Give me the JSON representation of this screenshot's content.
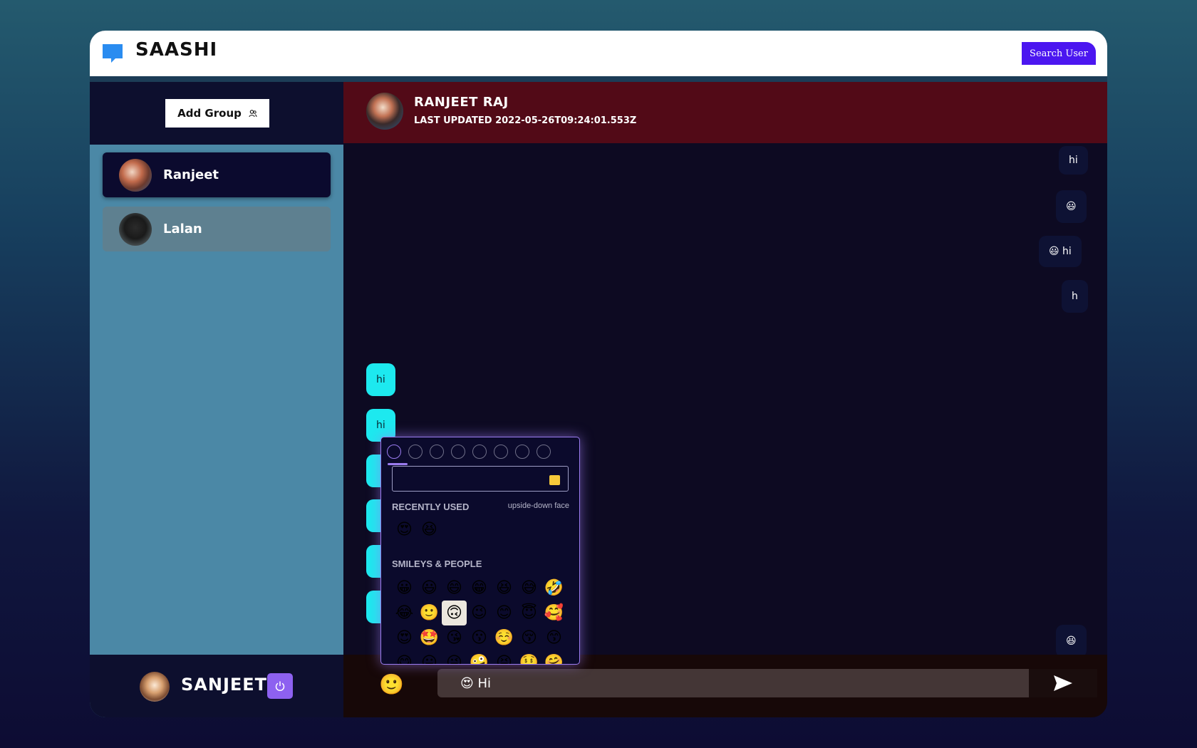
{
  "topbar": {
    "brand": "SAASHI",
    "search_label": "Search User"
  },
  "sidebar": {
    "add_group_label": "Add Group",
    "chats": [
      {
        "name": "Ranjeet",
        "active": true
      },
      {
        "name": "Lalan",
        "active": false
      }
    ],
    "me": {
      "name": "SANJEET"
    }
  },
  "chat_header": {
    "name": "RANJEET RAJ",
    "last_updated": "LAST UPDATED 2022-05-26T09:24:01.553Z"
  },
  "messages": [
    {
      "dir": "out",
      "text": "hi"
    },
    {
      "dir": "out",
      "text": "😃"
    },
    {
      "dir": "out",
      "text": "😃 hi"
    },
    {
      "dir": "out",
      "text": "h"
    },
    {
      "dir": "in",
      "text": "hi"
    },
    {
      "dir": "in",
      "text": "hi"
    },
    {
      "dir": "out",
      "text": "😆"
    }
  ],
  "emoji_picker": {
    "categories": [
      "frequently-used-icon",
      "smileys-icon",
      "animals-icon",
      "food-icon",
      "activity-icon",
      "travel-icon",
      "objects-icon",
      "symbols-icon"
    ],
    "recent_label": "RECENTLY USED",
    "preview_label": "upside-down face",
    "recent": [
      "😍",
      "😆"
    ],
    "smileys_label": "SMILEYS & PEOPLE",
    "smileys": [
      "😀",
      "😃",
      "😄",
      "😁",
      "😆",
      "😅",
      "🤣",
      "😂",
      "🙂",
      "🙃",
      "😉",
      "😊",
      "😇",
      "🥰",
      "😍",
      "🤩",
      "😘",
      "😗",
      "☺️",
      "😚",
      "😙",
      "😋",
      "😛",
      "😜",
      "🤪",
      "😝",
      "🤑",
      "🤗"
    ],
    "selected": "🙃"
  },
  "composer": {
    "input_value": "😍 Hi"
  },
  "colors": {
    "accent": "#4b16f0",
    "header": "#520a17",
    "incoming": "#1de9ef",
    "sidebar": "#4b88a6"
  }
}
